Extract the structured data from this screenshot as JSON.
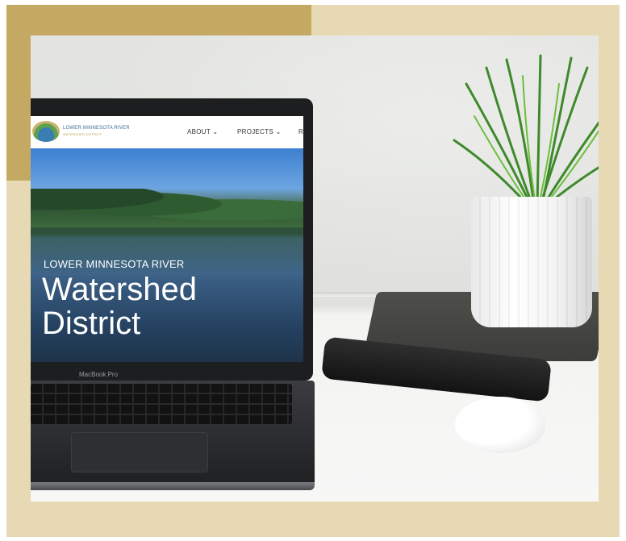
{
  "colors": {
    "frame_background": "#e7d9b4",
    "frame_accent": "#c4a963"
  },
  "laptop": {
    "brand_label": "MacBook Pro",
    "website": {
      "logo_icon": "watershed-logo-icon",
      "logo_title": "LOWER MINNESOTA RIVER",
      "logo_subtitle": "WATERSHED DISTRICT",
      "nav": [
        {
          "label": "ABOUT ⌄"
        },
        {
          "label": "PROJECTS ⌄"
        },
        {
          "label": "R"
        }
      ],
      "hero_kicker": "LOWER MINNESOTA RIVER",
      "hero_title_line1": "Watershed",
      "hero_title_line2": "District"
    }
  }
}
